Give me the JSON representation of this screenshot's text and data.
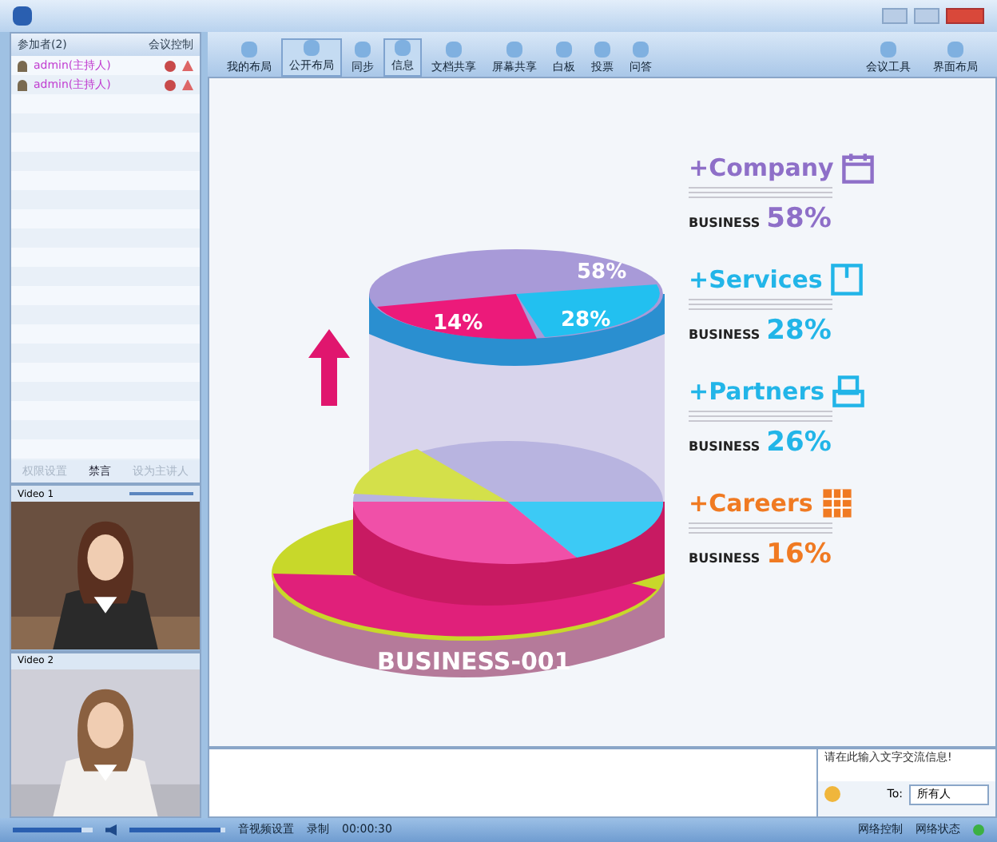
{
  "panel": {
    "title": "参加者(2)",
    "control": "会议控制"
  },
  "participants": [
    {
      "name": "admin(主持人)"
    },
    {
      "name": "admin(主持人)"
    }
  ],
  "panel_buttons": [
    {
      "label": "权限设置",
      "disabled": true
    },
    {
      "label": "禁言",
      "disabled": false
    },
    {
      "label": "设为主讲人",
      "disabled": true
    }
  ],
  "videos": [
    {
      "label": "Video 1"
    },
    {
      "label": "Video 2"
    }
  ],
  "toolbar": [
    {
      "label": "我的布局",
      "selected": false
    },
    {
      "label": "公开布局",
      "selected": true
    },
    {
      "label": "同步",
      "selected": false
    },
    {
      "label": "信息",
      "selected": true
    },
    {
      "label": "文档共享",
      "selected": false
    },
    {
      "label": "屏幕共享",
      "selected": false
    },
    {
      "label": "白板",
      "selected": false
    },
    {
      "label": "投票",
      "selected": false
    },
    {
      "label": "问答",
      "selected": false
    }
  ],
  "toolbar_right": [
    {
      "label": "会议工具"
    },
    {
      "label": "界面布局"
    }
  ],
  "slide": {
    "pie_labels": [
      "58%",
      "28%",
      "14%"
    ],
    "base_label": "BUSINESS-001",
    "items": [
      {
        "title": "+Company",
        "business": "BUSINESS",
        "percent": "58%",
        "color": "#8e6fc8"
      },
      {
        "title": "+Services",
        "business": "BUSINESS",
        "percent": "28%",
        "color": "#22b5e8"
      },
      {
        "title": "+Partners",
        "business": "BUSINESS",
        "percent": "26%",
        "color": "#22b5e8"
      },
      {
        "title": "+Careers",
        "business": "BUSINESS",
        "percent": "16%",
        "color": "#f07a22"
      }
    ]
  },
  "chat": {
    "placeholder": "请在此输入文字交流信息!",
    "to_label": "To:",
    "recipient": "所有人"
  },
  "status_bar": {
    "mic_volume": {
      "level": 0.85
    },
    "speaker_volume": {
      "level": 0.95
    },
    "av_settings": "音视频设置",
    "record": "录制",
    "time": "00:00:30",
    "network_control": "网络控制",
    "network_status": "网络状态"
  }
}
